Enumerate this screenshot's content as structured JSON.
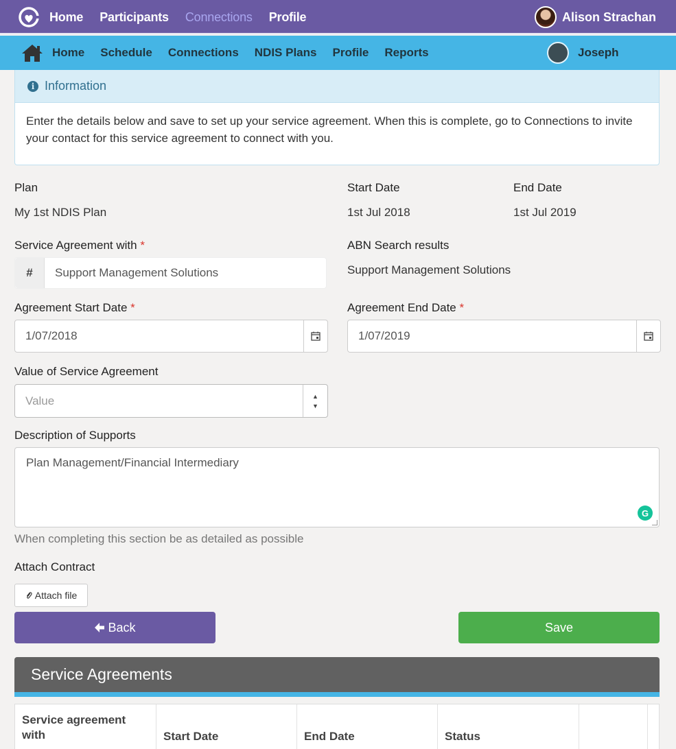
{
  "topbar": {
    "nav": [
      "Home",
      "Participants",
      "Connections",
      "Profile"
    ],
    "active_index": 2,
    "user_name": "Alison Strachan"
  },
  "subbar": {
    "nav": [
      "Home",
      "Schedule",
      "Connections",
      "NDIS Plans",
      "Profile",
      "Reports"
    ],
    "user_name": "Joseph"
  },
  "info": {
    "title": "Information",
    "body": "Enter the details below and save to set up your service agreement. When this is complete, go to Connections to invite your contact for this service agreement to connect with you."
  },
  "plan": {
    "plan_label": "Plan",
    "plan_value": "My 1st NDIS Plan",
    "start_label": "Start Date",
    "start_value": "1st Jul 2018",
    "end_label": "End Date",
    "end_value": "1st Jul 2019"
  },
  "form": {
    "service_with_label": "Service Agreement with",
    "service_with_prefix": "#",
    "service_with_value": "Support Management Solutions",
    "abn_label": "ABN Search results",
    "abn_value": "Support Management Solutions",
    "agreement_start_label": "Agreement Start Date",
    "agreement_start_value": "1/07/2018",
    "agreement_end_label": "Agreement End Date",
    "agreement_end_value": "1/07/2019",
    "value_label": "Value of Service Agreement",
    "value_placeholder": "Value",
    "description_label": "Description of Supports",
    "description_value": "Plan Management/Financial Intermediary",
    "description_help": "When completing this section be as detailed as possible",
    "attach_label": "Attach Contract",
    "attach_button": "Attach file",
    "required_mark": "*"
  },
  "actions": {
    "back": "Back",
    "save": "Save"
  },
  "agreements": {
    "title": "Service Agreements",
    "columns": [
      "Service agreement with",
      "Start Date",
      "End Date",
      "Status",
      ""
    ]
  },
  "colors": {
    "primary_purple": "#6a5aa3",
    "secondary_blue": "#45b5e5",
    "success_green": "#4cae4c",
    "required_red": "#d9342b"
  }
}
